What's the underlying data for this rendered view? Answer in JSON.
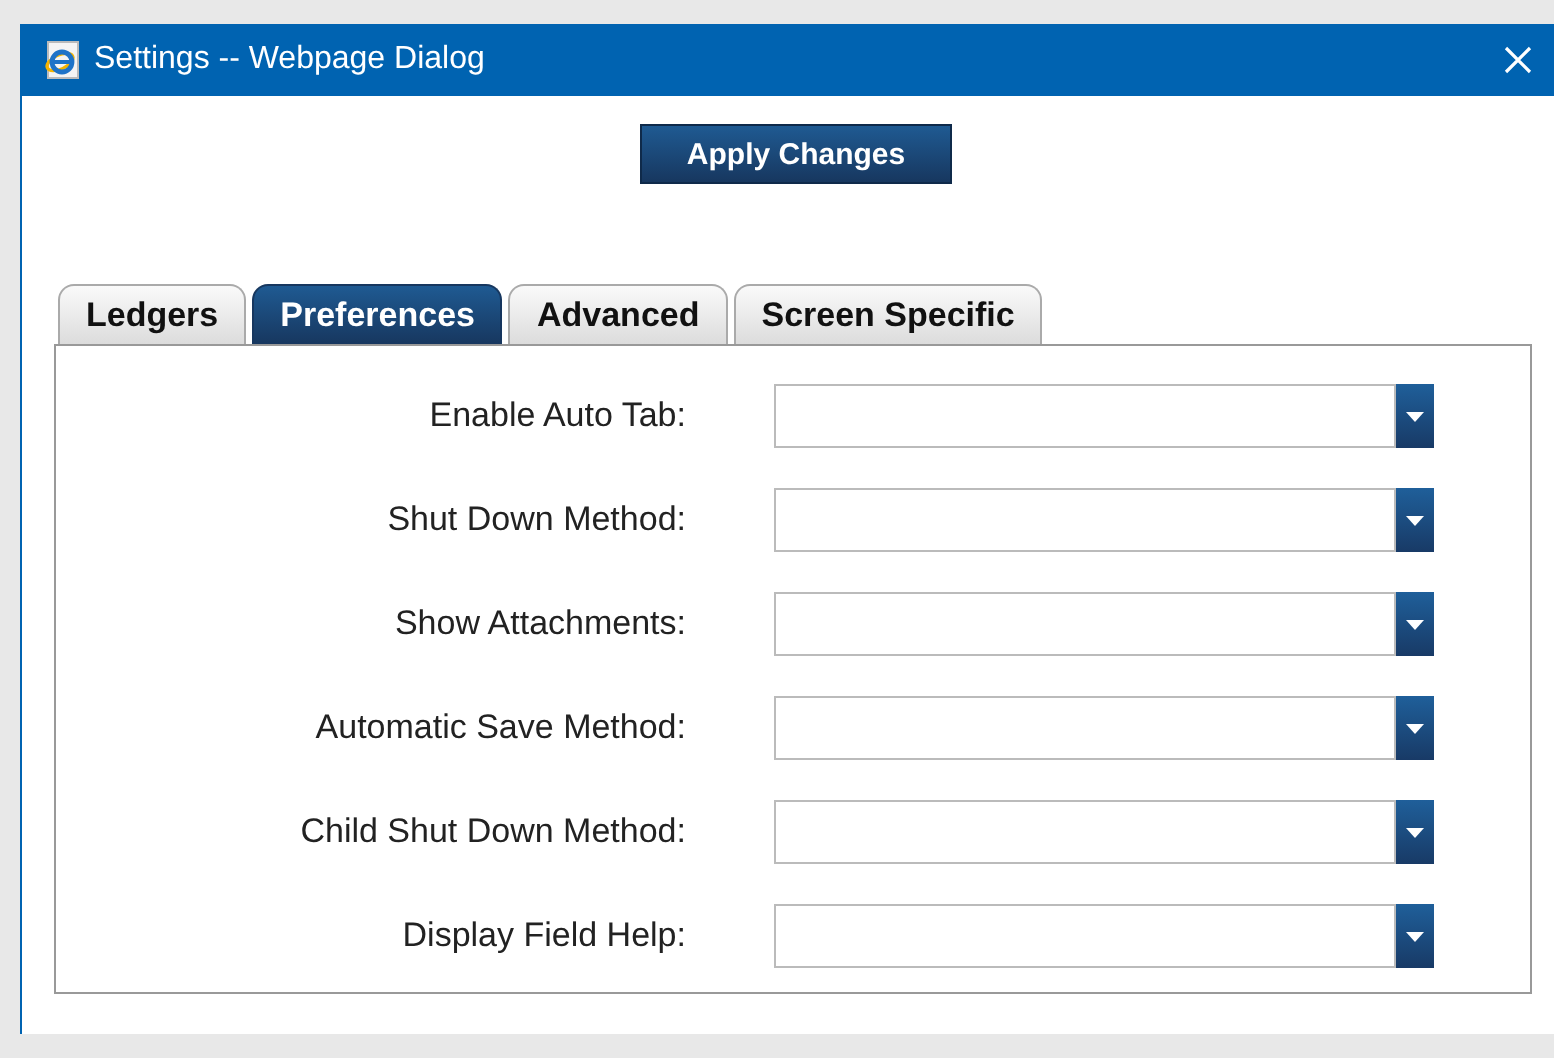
{
  "window": {
    "title": "Settings -- Webpage Dialog"
  },
  "apply_button": "Apply Changes",
  "tabs": [
    {
      "label": "Ledgers",
      "selected": false
    },
    {
      "label": "Preferences",
      "selected": true
    },
    {
      "label": "Advanced",
      "selected": false
    },
    {
      "label": "Screen Specific",
      "selected": false
    }
  ],
  "fields": [
    {
      "label": "Enable Auto Tab:"
    },
    {
      "label": "Shut Down Method:"
    },
    {
      "label": "Show Attachments:"
    },
    {
      "label": "Automatic Save Method:"
    },
    {
      "label": "Child Shut Down Method:"
    },
    {
      "label": "Display Field Help:"
    }
  ]
}
